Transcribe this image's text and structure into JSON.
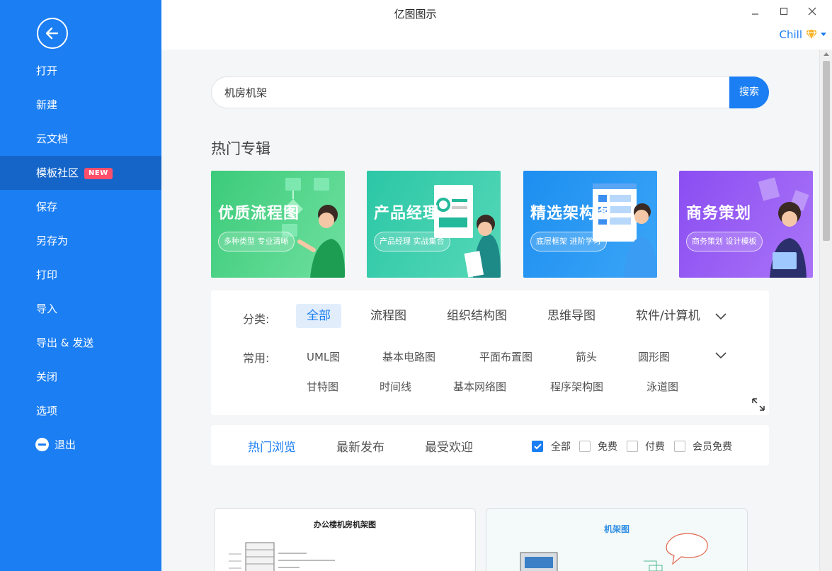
{
  "app": {
    "title": "亿图图示"
  },
  "user": {
    "name": "Chill"
  },
  "sidebar": {
    "items": [
      {
        "label": "打开"
      },
      {
        "label": "新建"
      },
      {
        "label": "云文档"
      },
      {
        "label": "模板社区",
        "badge": "NEW"
      },
      {
        "label": "保存"
      },
      {
        "label": "另存为"
      },
      {
        "label": "打印"
      },
      {
        "label": "导入"
      },
      {
        "label": "导出 & 发送"
      },
      {
        "label": "关闭"
      },
      {
        "label": "选项"
      },
      {
        "label": "退出"
      }
    ]
  },
  "search": {
    "value": "机房机架",
    "button_label": "搜索"
  },
  "hot": {
    "title": "热门专辑",
    "banners": [
      {
        "title": "优质流程图",
        "tag": "多种类型 专业清晰"
      },
      {
        "title": "产品经理",
        "tag": "产品经理 实战集合"
      },
      {
        "title": "精选架构图",
        "tag": "底层框架 进阶学习"
      },
      {
        "title": "商务策划",
        "tag": "商务策划 设计模板"
      }
    ]
  },
  "filters": {
    "category_label": "分类:",
    "categories": [
      "全部",
      "流程图",
      "组织结构图",
      "思维导图",
      "软件/计算机"
    ],
    "common_label": "常用:",
    "common_row1": [
      "UML图",
      "基本电路图",
      "平面布置图",
      "箭头",
      "圆形图"
    ],
    "common_row2": [
      "甘特图",
      "时间线",
      "基本网络图",
      "程序架构图",
      "泳道图"
    ]
  },
  "sort": {
    "tabs": [
      "热门浏览",
      "最新发布",
      "最受欢迎"
    ],
    "checks": [
      {
        "label": "全部",
        "checked": true
      },
      {
        "label": "免费",
        "checked": false
      },
      {
        "label": "付费",
        "checked": false
      },
      {
        "label": "会员免费",
        "checked": false
      }
    ]
  },
  "cards": [
    {
      "title": "办公楼机房机架图"
    },
    {
      "title": "机架图"
    }
  ],
  "colors": {
    "primary": "#1b7ef3",
    "sidebar_active": "#1565c9",
    "badge": "#ff4f6a"
  }
}
